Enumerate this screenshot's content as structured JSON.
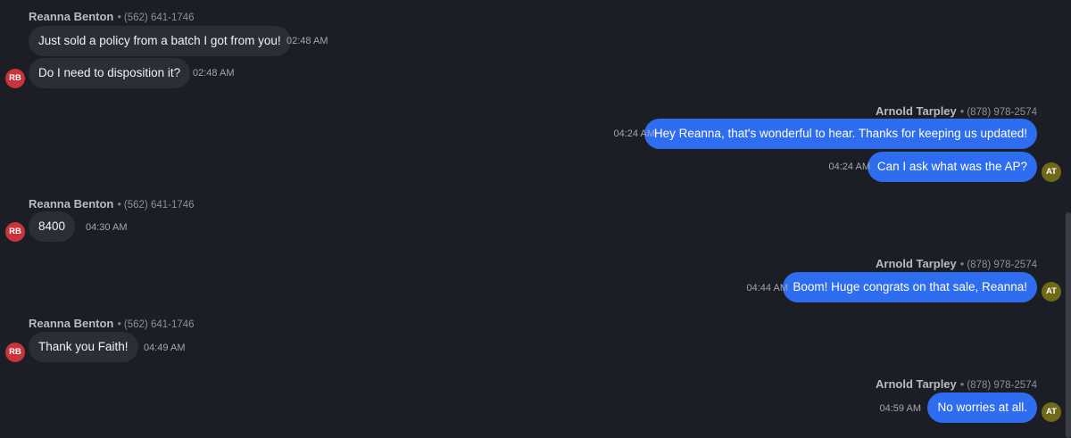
{
  "colors": {
    "background": "#1c1e25",
    "incoming_bubble": "#2b2e36",
    "outgoing_bubble": "#2f6df0",
    "avatar_rb": "#c9343c",
    "avatar_at": "#6e6a17"
  },
  "messages": [
    {
      "sender_name": "Reanna Benton",
      "sender_phone": "(562) 641-1746",
      "avatar": "RB",
      "lines": [
        {
          "text": "Just sold a policy from a batch I got from you!",
          "time": "02:48 AM"
        },
        {
          "text": "Do I need to disposition it?",
          "time": "02:48 AM"
        }
      ]
    },
    {
      "sender_name": "Arnold Tarpley",
      "sender_phone": "(878) 978-2574",
      "avatar": "AT",
      "lines": [
        {
          "text": "Hey Reanna, that's wonderful to hear. Thanks for keeping us updated!",
          "time": "04:24 AM"
        },
        {
          "text": "Can I ask what was the AP?",
          "time": "04:24 AM"
        }
      ]
    },
    {
      "sender_name": "Reanna Benton",
      "sender_phone": "(562) 641-1746",
      "avatar": "RB",
      "lines": [
        {
          "text": "8400",
          "time": "04:30 AM"
        }
      ]
    },
    {
      "sender_name": "Arnold Tarpley",
      "sender_phone": "(878) 978-2574",
      "avatar": "AT",
      "lines": [
        {
          "text": "Boom! Huge congrats on that sale, Reanna!",
          "time": "04:44 AM"
        }
      ]
    },
    {
      "sender_name": "Reanna Benton",
      "sender_phone": "(562) 641-1746",
      "avatar": "RB",
      "lines": [
        {
          "text": "Thank you Faith!",
          "time": "04:49 AM"
        }
      ]
    },
    {
      "sender_name": "Arnold Tarpley",
      "sender_phone": "(878) 978-2574",
      "avatar": "AT",
      "lines": [
        {
          "text": "No worries at all.",
          "time": "04:59 AM"
        }
      ]
    }
  ]
}
